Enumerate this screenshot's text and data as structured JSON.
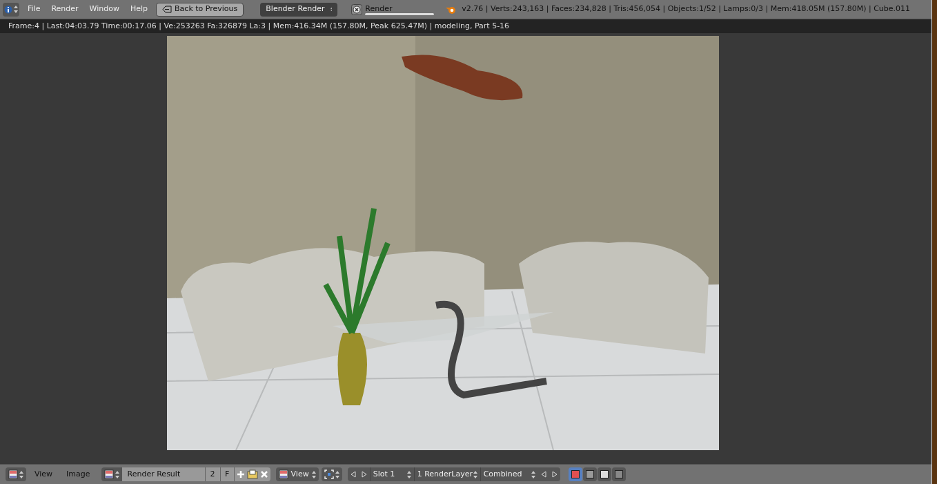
{
  "top_bar": {
    "menus": [
      "File",
      "Render",
      "Window",
      "Help"
    ],
    "back_button": "Back to Previous",
    "engine": "Blender Render",
    "render_job": {
      "label": "Render",
      "level": 1
    },
    "stats": "v2.76 | Verts:243,163 | Faces:234,828 | Tris:456,054 | Objects:1/52 | Lamps:0/3 | Mem:418.05M (157.80M) | Cube.011"
  },
  "info_line": "Frame:4 | Last:04:03.79 Time:00:17.06 | Ve:253263 Fa:326879 La:3 | Mem:416.34M (157.80M, Peak 625.47M) | modeling, Part 5-16",
  "bottom_bar": {
    "menus": [
      "View",
      "Image"
    ],
    "image_name": "Render Result",
    "users": "2",
    "fake_user": "F",
    "view": "View",
    "slot": "Slot 1",
    "layer": "1 RenderLayer",
    "pass": "Combined",
    "display_modes": [
      {
        "kind": "color-alpha",
        "selected": true
      },
      {
        "kind": "alpha",
        "selected": false
      },
      {
        "kind": "z",
        "selected": false
      },
      {
        "kind": "channels",
        "selected": false
      }
    ]
  }
}
